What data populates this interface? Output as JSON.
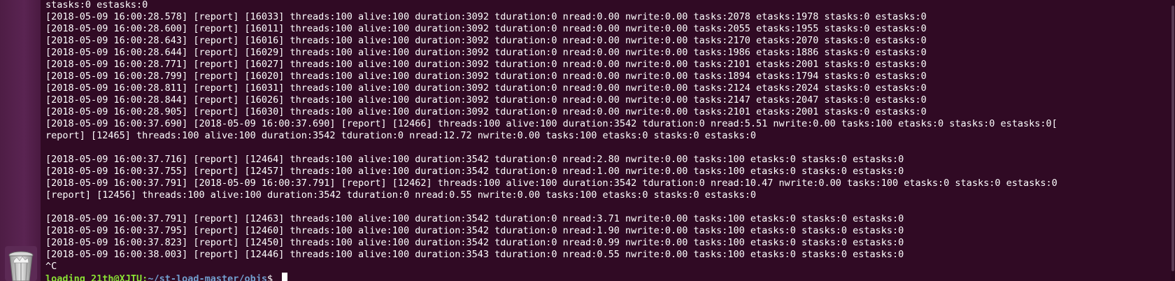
{
  "terminal": {
    "lines": [
      "stasks:0 estasks:0",
      "[2018-05-09 16:00:28.578] [report] [16033] threads:100 alive:100 duration:3092 tduration:0 nread:0.00 nwrite:0.00 tasks:2078 etasks:1978 stasks:0 estasks:0",
      "[2018-05-09 16:00:28.600] [report] [16011] threads:100 alive:100 duration:3092 tduration:0 nread:0.00 nwrite:0.00 tasks:2055 etasks:1955 stasks:0 estasks:0",
      "[2018-05-09 16:00:28.643] [report] [16016] threads:100 alive:100 duration:3092 tduration:0 nread:0.00 nwrite:0.00 tasks:2170 etasks:2070 stasks:0 estasks:0",
      "[2018-05-09 16:00:28.644] [report] [16029] threads:100 alive:100 duration:3092 tduration:0 nread:0.00 nwrite:0.00 tasks:1986 etasks:1886 stasks:0 estasks:0",
      "[2018-05-09 16:00:28.771] [report] [16027] threads:100 alive:100 duration:3092 tduration:0 nread:0.00 nwrite:0.00 tasks:2101 etasks:2001 stasks:0 estasks:0",
      "[2018-05-09 16:00:28.799] [report] [16020] threads:100 alive:100 duration:3092 tduration:0 nread:0.00 nwrite:0.00 tasks:1894 etasks:1794 stasks:0 estasks:0",
      "[2018-05-09 16:00:28.811] [report] [16031] threads:100 alive:100 duration:3092 tduration:0 nread:0.00 nwrite:0.00 tasks:2124 etasks:2024 stasks:0 estasks:0",
      "[2018-05-09 16:00:28.844] [report] [16026] threads:100 alive:100 duration:3092 tduration:0 nread:0.00 nwrite:0.00 tasks:2147 etasks:2047 stasks:0 estasks:0",
      "[2018-05-09 16:00:28.905] [report] [16030] threads:100 alive:100 duration:3092 tduration:0 nread:0.00 nwrite:0.00 tasks:2101 etasks:2001 stasks:0 estasks:0",
      "[2018-05-09 16:00:37.690] [2018-05-09 16:00:37.690] [report] [12466] threads:100 alive:100 duration:3542 tduration:0 nread:5.51 nwrite:0.00 tasks:100 etasks:0 stasks:0 estasks:0[",
      "report] [12465] threads:100 alive:100 duration:3542 tduration:0 nread:12.72 nwrite:0.00 tasks:100 etasks:0 stasks:0 estasks:0",
      "",
      "[2018-05-09 16:00:37.716] [report] [12464] threads:100 alive:100 duration:3542 tduration:0 nread:2.80 nwrite:0.00 tasks:100 etasks:0 stasks:0 estasks:0",
      "[2018-05-09 16:00:37.755] [report] [12457] threads:100 alive:100 duration:3542 tduration:0 nread:1.00 nwrite:0.00 tasks:100 etasks:0 stasks:0 estasks:0",
      "[2018-05-09 16:00:37.791] [2018-05-09 16:00:37.791] [report] [12462] threads:100 alive:100 duration:3542 tduration:0 nread:10.47 nwrite:0.00 tasks:100 etasks:0 stasks:0 estasks:0",
      "[report] [12456] threads:100 alive:100 duration:3542 tduration:0 nread:0.55 nwrite:0.00 tasks:100 etasks:0 stasks:0 estasks:0",
      "",
      "[2018-05-09 16:00:37.791] [report] [12463] threads:100 alive:100 duration:3542 tduration:0 nread:3.71 nwrite:0.00 tasks:100 etasks:0 stasks:0 estasks:0",
      "[2018-05-09 16:00:37.795] [report] [12460] threads:100 alive:100 duration:3542 tduration:0 nread:1.90 nwrite:0.00 tasks:100 etasks:0 stasks:0 estasks:0",
      "[2018-05-09 16:00:37.823] [report] [12450] threads:100 alive:100 duration:3542 tduration:0 nread:0.99 nwrite:0.00 tasks:100 etasks:0 stasks:0 estasks:0",
      "[2018-05-09 16:00:38.003] [report] [12446] threads:100 alive:100 duration:3543 tduration:0 nread:0.55 nwrite:0.00 tasks:100 etasks:0 stasks:0 estasks:0",
      "^C"
    ],
    "prompt": {
      "user_host": "loading_21th@XJTU",
      "separator": ":",
      "path": "~/st-load-master/objs",
      "symbol": "$ "
    }
  },
  "launcher": {
    "trash_icon": "trash-icon"
  },
  "colors": {
    "terminal_bg": "#300a24",
    "launcher_bg": "#5a2452",
    "prompt_user": "#8ae234",
    "prompt_path": "#729fcf",
    "text": "#ffffff"
  }
}
